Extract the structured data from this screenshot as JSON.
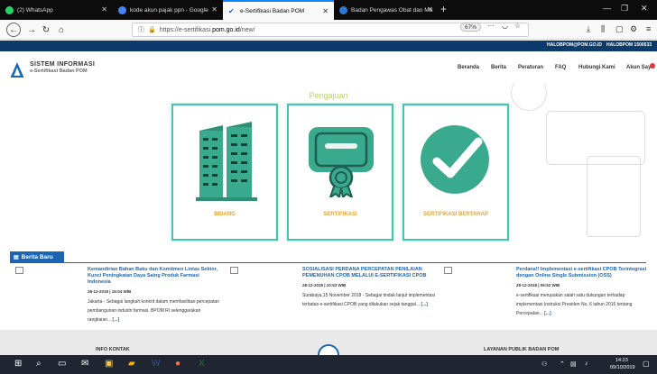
{
  "browser": {
    "tabs": [
      {
        "label": "(2) WhatsApp",
        "color": "#25d366"
      },
      {
        "label": "kode akun pajak ppn - Google",
        "color": "#4285f4"
      },
      {
        "label": "e-Sertifikasi Badan POM",
        "color": "#1b66b2"
      },
      {
        "label": "Badan Pengawas Obat dan Ma",
        "color": "#2a7bd1"
      }
    ],
    "active_tab_index": 2,
    "url_prefix": "https://e-sertifikasi.",
    "url_domain": "pom.go.id",
    "url_suffix": "/new/",
    "zoom": "67%"
  },
  "site": {
    "top_strip": {
      "email": "HALOBPOM@POM.GO.ID",
      "phone": "HALOBPOM 1500533"
    },
    "logo_title": "SISTEM INFORMASI",
    "logo_subtitle": "e-Sertifikasi Badan POM",
    "menu": [
      "Beranda",
      "Berita",
      "Peraturan",
      "FAQ",
      "Hubungi Kami",
      "Akun Saya"
    ],
    "hero_title": "Pengajuan",
    "cards": [
      {
        "label": "BIDANG"
      },
      {
        "label": "SERTIFIKASI"
      },
      {
        "label": "SERTIFIKASI BERTAHAP"
      }
    ],
    "news_header": "Berita Baru",
    "news": [
      {
        "title": "Kemandirian Bahan Baku dan Komitmen Lintas Sektor, Kunci Peningkatan Daya Saing Produk Farmasi Indonesia",
        "date": "28-12-2018 | 16:04 WIB",
        "body": "Jakarta - Sebagai langkah konkrit dalam memfasilitasi percepatan pembangunan industri farmasi, BPOM RI selenggarakan rangkaian...",
        "more": "[...]"
      },
      {
        "title": "SOSIALISASI PERDANA PERCEPATAN PENILAIAN PEMENUHAN CPOB MELALUI E-SERTIFIKASI CPOB",
        "date": "28-12-2018 | 10:53 WIB",
        "body": "Surabaya,15 November 2018 - Sebagai tindak lanjut implementasi terbatas e-sertifikasi CPOB yang dilakukan sejak tanggal...",
        "more": "[...]"
      },
      {
        "title": "Perdana!! Implementasi e-sertifikasi CPOB Terintegrasi dengan Online Single Submission (OSS)",
        "date": "28-12-2018 | 09:52 WIB",
        "body": "e-sertifikasi merupakan salah satu dukungan terhadap implementasi Instruksi Presiden No. 6 tahun 2016 tentang Percepatan...",
        "more": "[...]"
      }
    ],
    "footer_left": "INFO KONTAK",
    "footer_right": "LAYANAN PUBLIK BADAN POM"
  },
  "taskbar": {
    "time": "14:23",
    "date": "09/10/2019"
  },
  "colors": {
    "accent_teal": "#44c5b0",
    "card_label": "#e8a32e",
    "brand_blue": "#1b66b2"
  }
}
